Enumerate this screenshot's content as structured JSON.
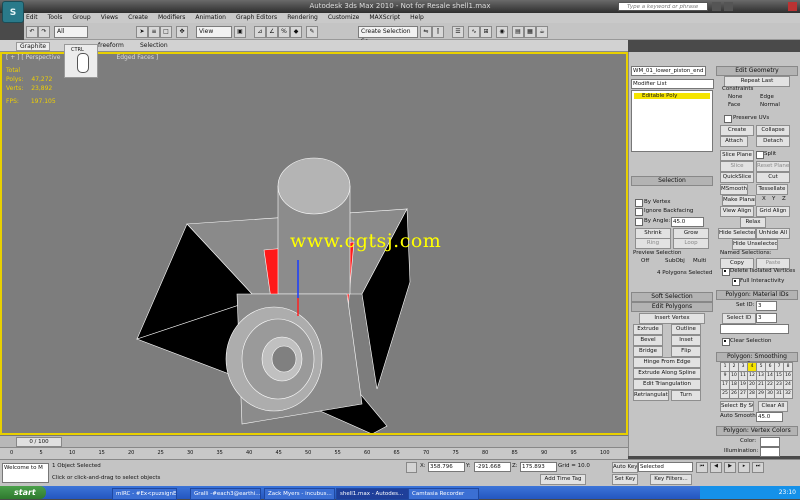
{
  "window": {
    "title": "Autodesk 3ds Max  2010   -  Not for Resale    shell1.max",
    "logo": "S",
    "help_search_placeholder": "Type a keyword or phrase"
  },
  "menu": [
    "Edit",
    "Tools",
    "Group",
    "Views",
    "Create",
    "Modifiers",
    "Animation",
    "Graph Editors",
    "Rendering",
    "Customize",
    "MAXScript",
    "Help"
  ],
  "toolbar": {
    "selection_filter": "All",
    "ref_coord": "View",
    "named_selection": "Create Selection Se"
  },
  "ribbon": {
    "tabs": [
      "Graphite",
      "freeform",
      "Selection"
    ]
  },
  "viewport": {
    "label": "[ + ] [ Perspective",
    "label_tail": "Edged Faces ]",
    "mouse_hint": "CTRL",
    "stats": [
      {
        "label": "Total",
        "value": ""
      },
      {
        "label": "Polys:",
        "value": "47,272"
      },
      {
        "label": "Verts:",
        "value": "23,892"
      },
      {
        "label": "FPS:",
        "value": "197.105"
      }
    ],
    "watermark": "www.cgtsj.com"
  },
  "command_panel": {
    "object_name": "WM_01_lower_piston_end",
    "modifier_list": "Modifier List",
    "stack_item": "Editable Poly",
    "selection": {
      "title": "Selection",
      "by_vertex": "By Vertex",
      "ignore_backfacing": "Ignore Backfacing",
      "by_angle": "By Angle:",
      "angle_value": "45.0",
      "shrink": "Shrink",
      "grow": "Grow",
      "ring": "Ring",
      "loop": "Loop",
      "preview": "Preview Selection",
      "off": "Off",
      "subobj": "SubObj",
      "multi": "Multi",
      "status": "4 Polygons Selected"
    },
    "soft_selection": "Soft Selection",
    "edit_polygons": {
      "title": "Edit Polygons",
      "insert_vertex": "Insert Vertex",
      "extrude": "Extrude",
      "outline": "Outline",
      "bevel": "Bevel",
      "inset": "Inset",
      "bridge": "Bridge",
      "flip": "Flip",
      "hinge": "Hinge From Edge",
      "extrude_spline": "Extrude Along Spline",
      "edit_tri": "Edit Triangulation",
      "retri": "Retriangulate",
      "turn": "Turn"
    }
  },
  "edit_geometry": {
    "title": "Edit Geometry",
    "repeat_last": "Repeat Last",
    "constraints": "Constraints",
    "none": "None",
    "edge": "Edge",
    "face": "Face",
    "normal": "Normal",
    "preserve_uvs": "Preserve UVs",
    "create": "Create",
    "collapse": "Collapse",
    "attach": "Attach",
    "detach": "Detach",
    "slice_plane": "Slice Plane",
    "split": "Split",
    "slice": "Slice",
    "reset_plane": "Reset Plane",
    "quickslice": "QuickSlice",
    "cut": "Cut",
    "msmooth": "MSmooth",
    "tessellate": "Tessellate",
    "make_planar": "Make Planar",
    "x": "X",
    "y": "Y",
    "z": "Z",
    "view_align": "View Align",
    "grid_align": "Grid Align",
    "relax": "Relax",
    "hide_selected": "Hide Selected",
    "unhide_all": "Unhide All",
    "hide_unselected": "Hide Unselected",
    "named_selections": "Named Selections:",
    "copy": "Copy",
    "paste": "Paste",
    "delete_isolated": "Delete Isolated Vertices",
    "full_interactivity": "Full Interactivity"
  },
  "material_ids": {
    "title": "Polygon: Material IDs",
    "set_id": "Set ID:",
    "set_id_value": "3",
    "select_id": "Select ID",
    "select_id_value": "3",
    "clear_selection": "Clear Selection"
  },
  "smoothing_groups": {
    "title": "Polygon: Smoothing Groups",
    "groups": [
      "1",
      "2",
      "3",
      "4",
      "5",
      "6",
      "7",
      "8",
      "9",
      "10",
      "11",
      "12",
      "13",
      "14",
      "15",
      "16",
      "17",
      "18",
      "19",
      "20",
      "21",
      "22",
      "23",
      "24",
      "25",
      "26",
      "27",
      "28",
      "29",
      "30",
      "31",
      "32"
    ],
    "active": "4",
    "select_by_sg": "Select By SG",
    "clear_all": "Clear All",
    "auto_smooth": "Auto Smooth",
    "auto_smooth_value": "45.0"
  },
  "vertex_colors": {
    "title": "Polygon: Vertex Colors",
    "color": "Color:",
    "illumination": "Illumination:"
  },
  "timeline": {
    "frame": "0 / 100",
    "ticks": [
      "0",
      "5",
      "10",
      "15",
      "20",
      "25",
      "30",
      "35",
      "40",
      "45",
      "50",
      "55",
      "60",
      "65",
      "70",
      "75",
      "80",
      "85",
      "90",
      "95",
      "100"
    ]
  },
  "status": {
    "maxscript": "Welcome to M",
    "selected": "1 Object Selected",
    "prompt": "Click or click-and-drag to select objects",
    "x": "358.796",
    "y": "-291.668",
    "z": "175.893",
    "grid": "Grid = 10.0",
    "auto_key": "Auto Key",
    "set_key": "Set Key",
    "key_mode": "Selected",
    "key_filters": "Key Filters...",
    "add_time_tag": "Add Time Tag"
  },
  "taskbar": {
    "start": "start",
    "tasks": [
      "mIRC - #Ex<puzsignE><",
      "Gralli -#each3@earthi...",
      "Zack Myers - incubus...",
      "shell1.max - Autodes...",
      "Camtasia Recorder"
    ],
    "clock": "23:10"
  },
  "colors": {
    "viewport_border": "#e8d000",
    "stack_highlight": "#f5e400",
    "selected_face": "#ff1a1a"
  }
}
